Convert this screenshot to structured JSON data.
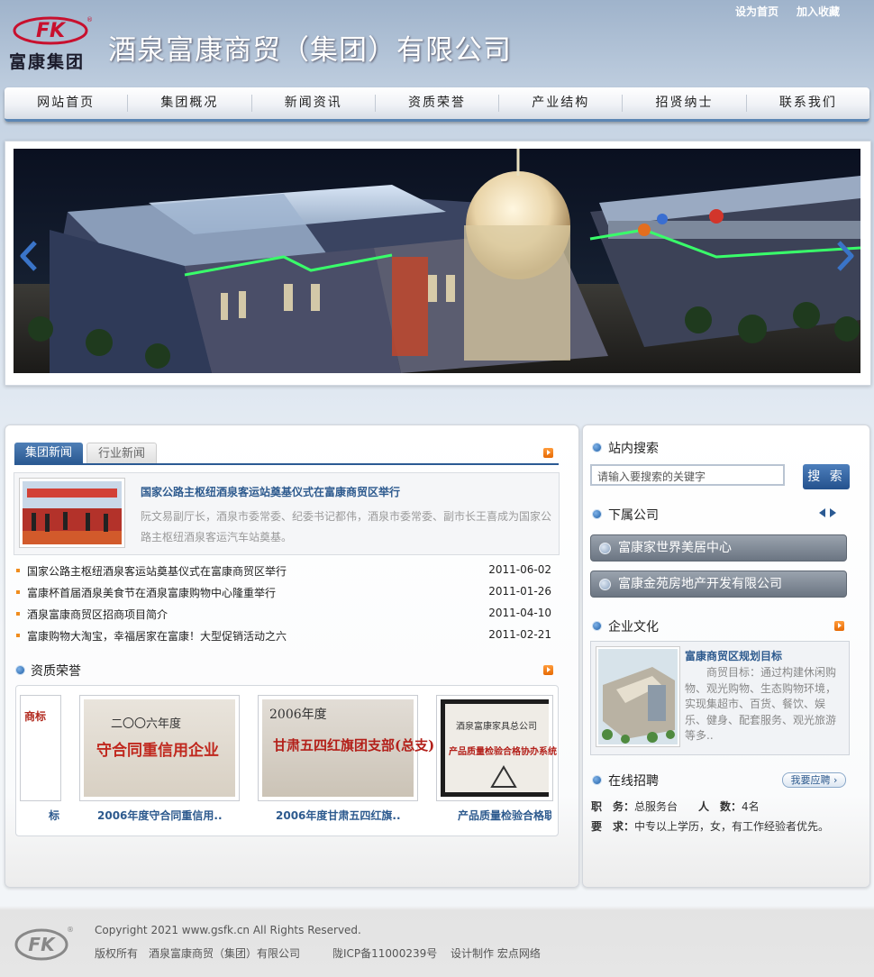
{
  "header": {
    "logo_text": "富康集团",
    "company_name": "酒泉富康商贸（集团）有限公司",
    "set_home": "设为首页",
    "add_favorite": "加入收藏"
  },
  "nav": {
    "items": [
      "网站首页",
      "集团概况",
      "新闻资讯",
      "资质荣誉",
      "产业结构",
      "招贤纳士",
      "联系我们"
    ]
  },
  "news": {
    "tab_group": "集团新闻",
    "tab_industry": "行业新闻",
    "featured_title": "国家公路主枢纽酒泉客运站奠基仪式在富康商贸区举行",
    "featured_desc": "阮文易副厅长，酒泉市委常委、纪委书记都伟，酒泉市委常委、副市长王喜成为国家公路主枢纽酒泉客运汽车站奠基。",
    "list": [
      {
        "title": "国家公路主枢纽酒泉客运站奠基仪式在富康商贸区举行",
        "date": "2011-06-02"
      },
      {
        "title": "富康杯首届酒泉美食节在酒泉富康购物中心隆重举行",
        "date": "2011-01-26"
      },
      {
        "title": "酒泉富康商贸区招商项目简介",
        "date": "2011-04-10"
      },
      {
        "title": "富康购物大淘宝，幸福居家在富康！大型促销活动之六",
        "date": "2011-02-21"
      }
    ]
  },
  "honors": {
    "title": "资质荣誉",
    "items": [
      {
        "caption": "标",
        "cert_text": "商标"
      },
      {
        "caption": "2006年度守合同重信用..",
        "cert_year": "二〇〇六年度",
        "cert_text": "守合同重信用企业"
      },
      {
        "caption": "2006年度甘肃五四红旗..",
        "cert_year": "2006年度",
        "cert_text": "甘肃五四红旗团支部(总支)"
      },
      {
        "caption": "产品质量检验合格联",
        "cert_year": "酒泉富康家具总公司",
        "cert_text": "产品质量检验合格协办系统"
      }
    ]
  },
  "search": {
    "title": "站内搜索",
    "placeholder": "请输入要搜索的关键字",
    "button": "搜 索"
  },
  "subsidiaries": {
    "title": "下属公司",
    "items": [
      "富康家世界美居中心",
      "富康金苑房地产开发有限公司"
    ]
  },
  "culture": {
    "title": "企业文化",
    "item_title": "富康商贸区规划目标",
    "item_desc": "商贸目标：通过构建休闲购物、观光购物、生态购物环境，实现集超市、百货、餐饮、娱乐、健身、配套服务、观光旅游等多.."
  },
  "recruit": {
    "title": "在线招聘",
    "apply": "我要应聘",
    "position_label": "职　务：",
    "position": "总服务台",
    "count_label": "人　数：",
    "count": "4名",
    "requirement_label": "要　求：",
    "requirement": "中专以上学历，女，有工作经验者优先。"
  },
  "footer": {
    "copyright": "Copyright 2021 www.gsfk.cn All Rights Reserved.",
    "owner": "版权所有　酒泉富康商贸（集团）有限公司",
    "icp": "陇ICP备11000239号",
    "design": "设计制作 宏点网络"
  },
  "colors": {
    "accent": "#2b5a93",
    "link": "#2d5a8e",
    "bullet": "#f08d1e"
  }
}
